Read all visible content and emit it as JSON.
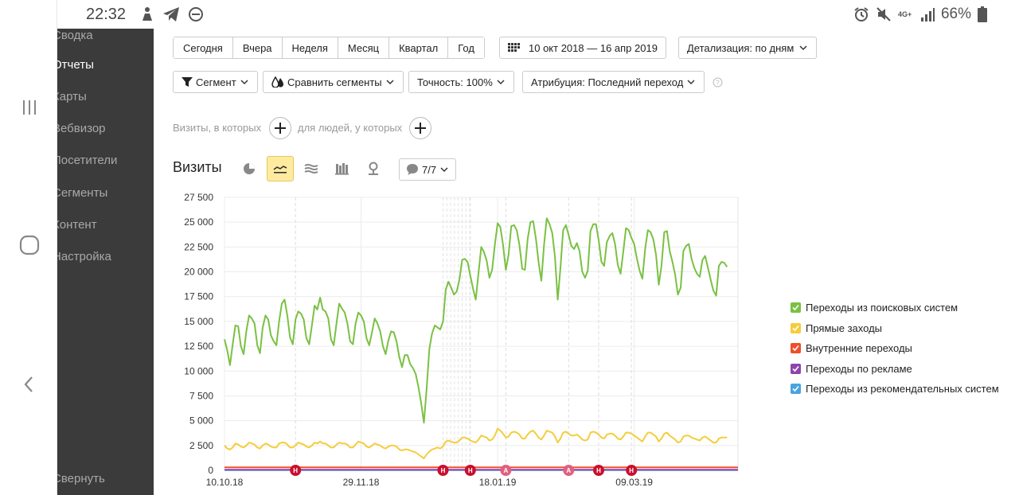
{
  "status_bar": {
    "time": "22:32",
    "network": "4G+",
    "battery": "66%"
  },
  "sidebar": {
    "items": [
      {
        "label": "Сводка",
        "active": false
      },
      {
        "label": "Отчеты",
        "active": true
      },
      {
        "label": "Карты",
        "active": false
      },
      {
        "label": "Вебвизор",
        "active": false
      },
      {
        "label": "Посетители",
        "active": false
      },
      {
        "label": "Сегменты",
        "active": false
      },
      {
        "label": "Контент",
        "active": false
      },
      {
        "label": "Настройка",
        "active": false
      }
    ],
    "collapse_label": "Свернуть"
  },
  "toolbar": {
    "periods": [
      "Сегодня",
      "Вчера",
      "Неделя",
      "Месяц",
      "Квартал",
      "Год"
    ],
    "date_range": "10 окт 2018 — 16 апр 2019",
    "detail": "Детализация: по дням",
    "segment": "Сегмент",
    "compare": "Сравнить сегменты",
    "accuracy": "Точность: 100%",
    "attribution": "Атрибуция: Последний переход"
  },
  "filters": {
    "visits_hint": "Визиты, в которых",
    "people_hint": "для людей, у которых"
  },
  "chart_section": {
    "title": "Визиты",
    "annotations_count": "7/7"
  },
  "chart_data": {
    "type": "line",
    "ylim": [
      0,
      27500
    ],
    "yticks": [
      "0",
      "2 500",
      "5 000",
      "7 500",
      "10 000",
      "12 500",
      "15 000",
      "17 500",
      "20 000",
      "22 500",
      "25 000",
      "27 500"
    ],
    "xlabels": [
      {
        "label": "10.10.18",
        "day": 0,
        "highlight": false
      },
      {
        "label": "29.11.18",
        "day": 50,
        "highlight": false
      },
      {
        "label": "18.01.19",
        "day": 100,
        "highlight": false
      },
      {
        "label": "09.03.19",
        "day": 150,
        "highlight": false
      }
    ],
    "days": 189,
    "markers": [
      {
        "day": 26,
        "type": "Н"
      },
      {
        "day": 80,
        "type": "Н"
      },
      {
        "day": 90,
        "type": "Н"
      },
      {
        "day": 103,
        "type": "А"
      },
      {
        "day": 126,
        "type": "А"
      },
      {
        "day": 137,
        "type": "Н"
      },
      {
        "day": 149,
        "type": "Н"
      }
    ],
    "series": [
      {
        "name": "Переходы из поисковых систем",
        "color": "#7ac143",
        "checked": true,
        "values": [
          13200,
          12100,
          10600,
          12700,
          14600,
          14500,
          12500,
          11700,
          14000,
          15600,
          15300,
          14800,
          12600,
          11800,
          14400,
          15600,
          15200,
          13600,
          13000,
          12600,
          15000,
          16800,
          17200,
          15600,
          13400,
          12700,
          15200,
          16000,
          15800,
          15200,
          13300,
          12700,
          14600,
          16600,
          16200,
          17400,
          16200,
          16000,
          15300,
          13200,
          12600,
          14800,
          16800,
          16300,
          15900,
          14800,
          13000,
          12700,
          14800,
          15900,
          15600,
          15000,
          13300,
          12600,
          13900,
          15300,
          14800,
          14000,
          12500,
          11700,
          13100,
          14000,
          13900,
          13000,
          11400,
          10400,
          11600,
          11600,
          10700,
          10300,
          9700,
          8400,
          6800,
          4800,
          8200,
          12200,
          13800,
          14600,
          14400,
          14200,
          15000,
          18200,
          19000,
          18400,
          17700,
          18000,
          19200,
          21200,
          21300,
          21000,
          19600,
          18300,
          17200,
          19900,
          22500,
          22000,
          21100,
          19400,
          20200,
          22800,
          24900,
          24500,
          22700,
          20200,
          21700,
          24600,
          24700,
          24200,
          22700,
          20300,
          20200,
          23300,
          25000,
          25100,
          23400,
          21000,
          19100,
          22700,
          25400,
          24800,
          23900,
          21500,
          17200,
          20400,
          24200,
          24700,
          23700,
          22600,
          22300,
          22900,
          22100,
          20000,
          19400,
          20100,
          24100,
          24800,
          24800,
          23200,
          21000,
          20600,
          23000,
          23600,
          23900,
          22800,
          20700,
          19800,
          22000,
          24400,
          24200,
          23400,
          22800,
          21300,
          20100,
          19300,
          22300,
          24200,
          24000,
          23300,
          21700,
          18700,
          20600,
          24000,
          24100,
          22100,
          21000,
          19700,
          17700,
          18400,
          22100,
          22600,
          22800,
          21300,
          20400,
          19800,
          19500,
          21200,
          21600,
          20400,
          19200,
          18100,
          17600,
          20600,
          21000,
          20900,
          20500
        ],
        "note": "raw values with artifacts; smoothing not applied"
      },
      {
        "name": "Прямые заходы",
        "color": "#f5cd3b",
        "checked": true,
        "values": [
          2500,
          2200,
          2100,
          2300,
          2700,
          2600,
          2400,
          2300,
          2500,
          2800,
          2700,
          2600,
          2300,
          2200,
          2500,
          2700,
          2600,
          2400,
          2300,
          2300,
          2700,
          2800,
          2800,
          2600,
          2300,
          2300,
          2500,
          2800,
          2700,
          2600,
          2400,
          2300,
          2500,
          2800,
          2700,
          2900,
          2700,
          2700,
          2500,
          2300,
          2300,
          2600,
          2800,
          2700,
          2700,
          2600,
          2300,
          2300,
          2600,
          2900,
          2800,
          2700,
          2400,
          2300,
          2500,
          2700,
          2600,
          2500,
          2300,
          2200,
          2400,
          2500,
          2500,
          2400,
          2100,
          2000,
          2100,
          2100,
          2000,
          1900,
          1800,
          1600,
          1400,
          1200,
          1600,
          1900,
          2100,
          2200,
          2300,
          2200,
          2400,
          2900,
          3000,
          2900,
          2800,
          2800,
          3000,
          3300,
          3300,
          3200,
          3000,
          2900,
          2800,
          3100,
          3500,
          3400,
          3300,
          3000,
          3100,
          3500,
          4200,
          4000,
          3700,
          3300,
          3400,
          3800,
          3900,
          3800,
          3600,
          3200,
          3200,
          3600,
          3900,
          4000,
          3700,
          3300,
          3100,
          3500,
          4000,
          3900,
          3800,
          3400,
          2800,
          3200,
          3800,
          3900,
          3700,
          3500,
          3500,
          3600,
          3400,
          3100,
          3000,
          3100,
          3800,
          3900,
          3800,
          3600,
          3300,
          3200,
          3600,
          3700,
          3700,
          3500,
          3200,
          3100,
          3400,
          3800,
          3800,
          3700,
          3500,
          3300,
          3100,
          2900,
          3400,
          3800,
          3800,
          3600,
          3400,
          2900,
          3200,
          3700,
          3800,
          3500,
          3300,
          3100,
          2800,
          2900,
          3400,
          3500,
          3500,
          3300,
          3200,
          3100,
          3000,
          3300,
          3400,
          3200,
          3000,
          2800,
          2800,
          3200,
          3300,
          3300,
          3300
        ]
      },
      {
        "name": "Внутренние переходы",
        "color": "#ef4e2b",
        "checked": true,
        "values_const": 300
      },
      {
        "name": "Переходы по рекламе",
        "color": "#8e44ad",
        "checked": true,
        "values_const": 60
      },
      {
        "name": "Переходы из рекомендательных систем",
        "color": "#4aa3df",
        "checked": true,
        "values_const": 20
      }
    ]
  }
}
